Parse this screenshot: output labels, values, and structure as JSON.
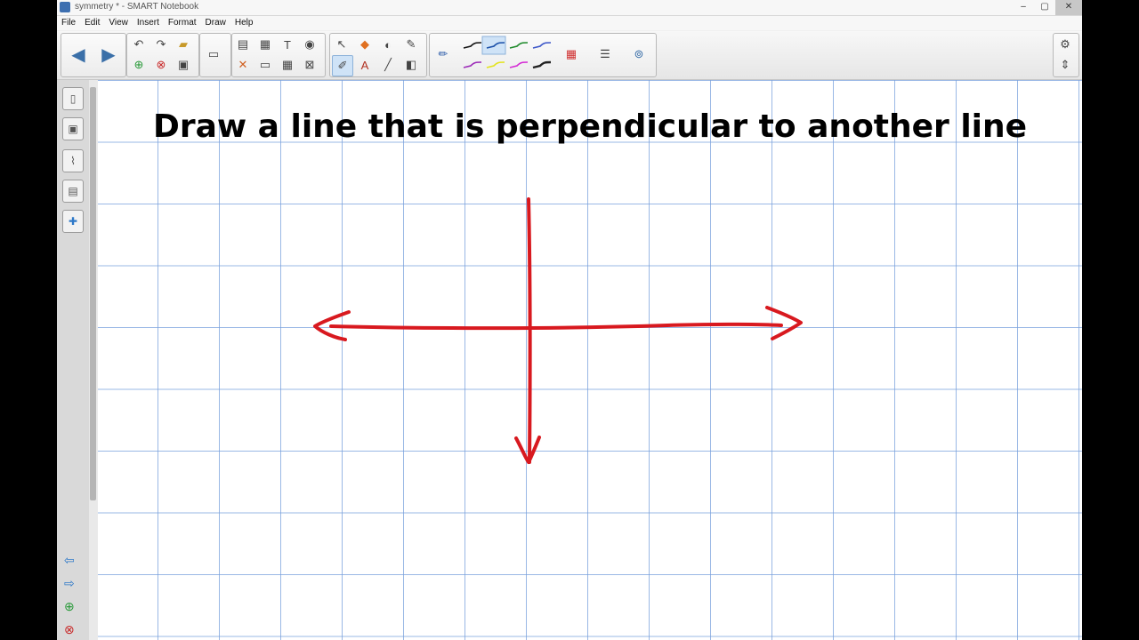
{
  "window": {
    "title": "symmetry * - SMART Notebook",
    "controls": [
      "–",
      "▢",
      "✕"
    ]
  },
  "menu": [
    "File",
    "Edit",
    "View",
    "Insert",
    "Format",
    "Draw",
    "Help"
  ],
  "toolbar": {
    "icons": {
      "back": "arrow-left-icon",
      "forward": "arrow-right-icon",
      "undo": "undo-icon",
      "redo": "redo-icon",
      "open": "folder-icon",
      "add_page": "add-page-icon",
      "delete_page": "delete-page-icon",
      "save": "save-icon",
      "display": "screen-icon",
      "paste": "paste-icon",
      "screenshade": "screen-shade-icon",
      "text_tool": "text-icon",
      "capture": "capture-icon",
      "delete": "delete-icon",
      "table": "table-icon",
      "close": "close-icon",
      "select": "select-icon",
      "shapes": "shapes-icon",
      "eraser": "eraser-icon",
      "magic_pen": "magic-pen-icon",
      "pens": "pens-icon",
      "text": "font-icon",
      "line": "line-icon",
      "fill": "fill-icon",
      "pencil": "pencil-icon",
      "colors": "color-palette-icon",
      "properties": "properties-icon",
      "link": "link-icon",
      "settings": "gear-icon",
      "move_toolbar": "move-toolbar-icon"
    },
    "pen_colors": [
      "#111111",
      "#1a4fa8",
      "#1d8a2a",
      "#3b55c8",
      "#9c2ab8",
      "#e3e31c",
      "#d42ad4",
      "#222222"
    ]
  },
  "side": {
    "tabs": [
      "page-sorter-icon",
      "gallery-icon",
      "attachments-icon",
      "properties-icon",
      "addons-icon"
    ],
    "nav": [
      "arrow-left-icon",
      "arrow-right-icon",
      "add-page-icon",
      "delete-page-icon"
    ]
  },
  "canvas": {
    "heading": "Draw a line that is perpendicular to another line",
    "ink_color": "#d8191f"
  }
}
